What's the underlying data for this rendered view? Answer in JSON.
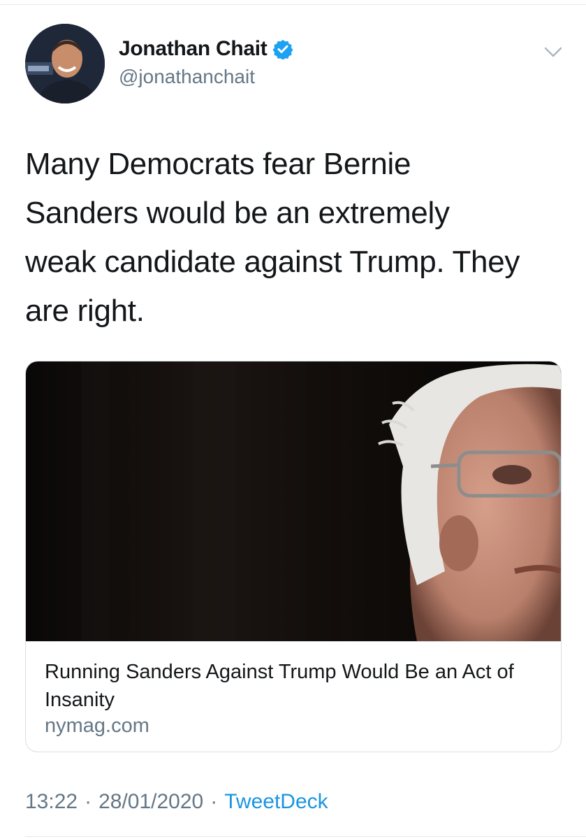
{
  "author": {
    "name": "Jonathan Chait",
    "handle": "@jonathanchait",
    "verified": true
  },
  "tweet": {
    "text": "Many Democrats fear Bernie\nSanders would be an extremely\nweak candidate against Trump. They\nare right."
  },
  "card": {
    "title": "Running Sanders Against Trump Would Be an Act of Insanity",
    "domain": "nymag.com"
  },
  "meta": {
    "time": "13:22",
    "separator1": "·",
    "date": "28/01/2020",
    "separator2": "·",
    "source": "TweetDeck"
  },
  "colors": {
    "link": "#1b95e0",
    "secondary_text": "#657786",
    "verified_badge": "#1da1f2"
  },
  "icons": {
    "verified": "verified-badge-icon",
    "menu": "chevron-down-icon"
  }
}
